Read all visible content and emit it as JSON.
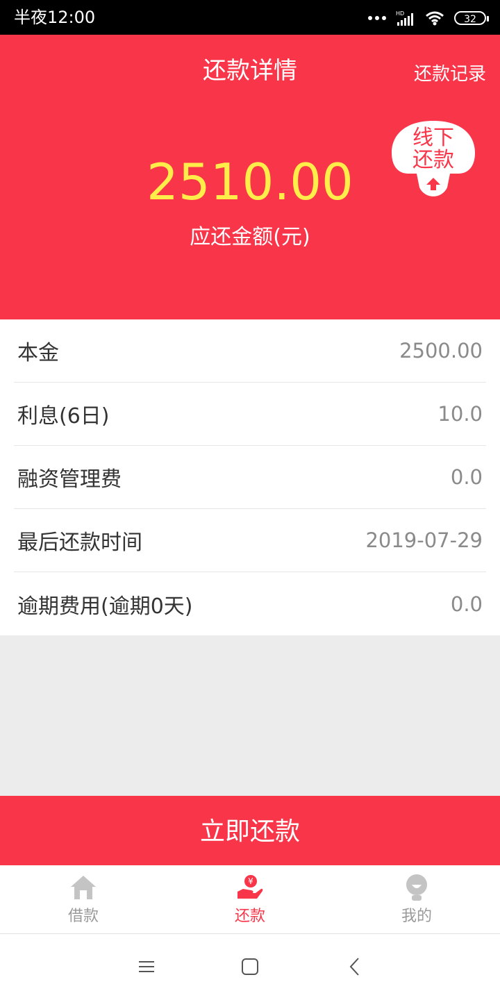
{
  "status_bar": {
    "time": "半夜12:00",
    "battery": "32"
  },
  "header": {
    "title": "还款详情",
    "records_link": "还款记录",
    "amount": "2510.00",
    "amount_label": "应还金额(元)",
    "offline_badge": {
      "line1": "线下",
      "line2": "还款"
    }
  },
  "details": [
    {
      "label": "本金",
      "value": "2500.00"
    },
    {
      "label": "利息(6日)",
      "value": "10.0"
    },
    {
      "label": "融资管理费",
      "value": "0.0"
    },
    {
      "label": "最后还款时间",
      "value": "2019-07-29"
    },
    {
      "label": "逾期费用(逾期0天)",
      "value": "0.0"
    }
  ],
  "repay_button": "立即还款",
  "tabs": [
    {
      "label": "借款",
      "icon": "home-icon"
    },
    {
      "label": "还款",
      "icon": "repay-hand-yen-icon",
      "active": true
    },
    {
      "label": "我的",
      "icon": "profile-icon"
    }
  ],
  "colors": {
    "primary": "#f93549",
    "amount": "#ffee4a"
  }
}
